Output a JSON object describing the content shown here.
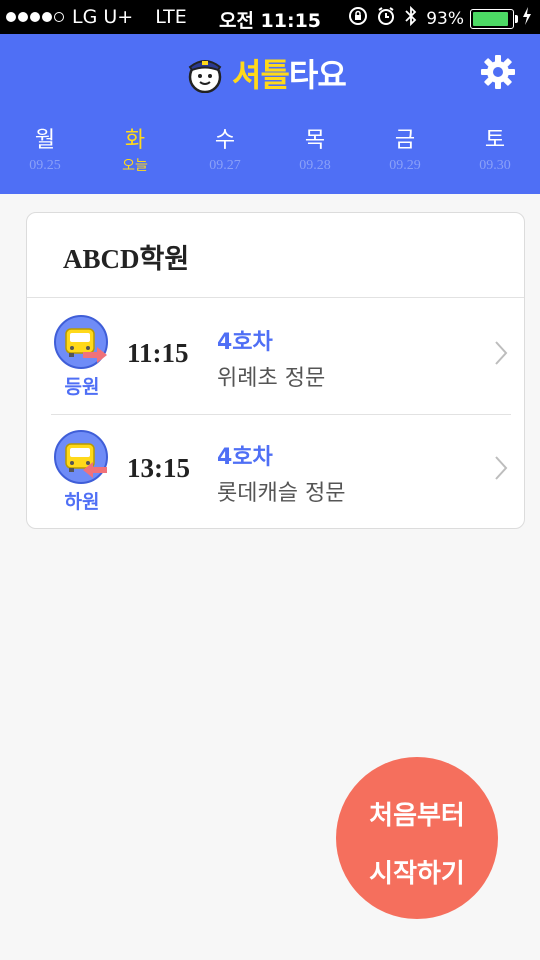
{
  "status_bar": {
    "carrier": "LG U+",
    "network": "LTE",
    "time": "오전 11:15",
    "battery_percent": "93%",
    "battery_level": 0.93,
    "icons": [
      "lock-rotation-icon",
      "alarm-icon",
      "bluetooth-icon",
      "charging-icon"
    ]
  },
  "header": {
    "logo_part1": "셔틀",
    "logo_part2": "타요",
    "settings_icon": "gear-icon",
    "bg_color": "#4f6ff5",
    "accent_color": "#ffd91a"
  },
  "days": [
    {
      "name": "월",
      "date": "09.25"
    },
    {
      "name": "화",
      "date": "오늘"
    },
    {
      "name": "수",
      "date": "09.27"
    },
    {
      "name": "목",
      "date": "09.28"
    },
    {
      "name": "금",
      "date": "09.29"
    },
    {
      "name": "토",
      "date": "09.30"
    }
  ],
  "academy": {
    "name": "ABCD학원",
    "trips": [
      {
        "type": "등원",
        "time": "11:15",
        "route": "4호차",
        "stop": "위례초 정문",
        "icon": "bus-arrive-icon"
      },
      {
        "type": "하원",
        "time": "13:15",
        "route": "4호차",
        "stop": "롯데캐슬 정문",
        "icon": "bus-depart-icon"
      }
    ]
  },
  "fab": {
    "line1": "처음부터",
    "line2": "시작하기",
    "color": "#f56f5d"
  }
}
